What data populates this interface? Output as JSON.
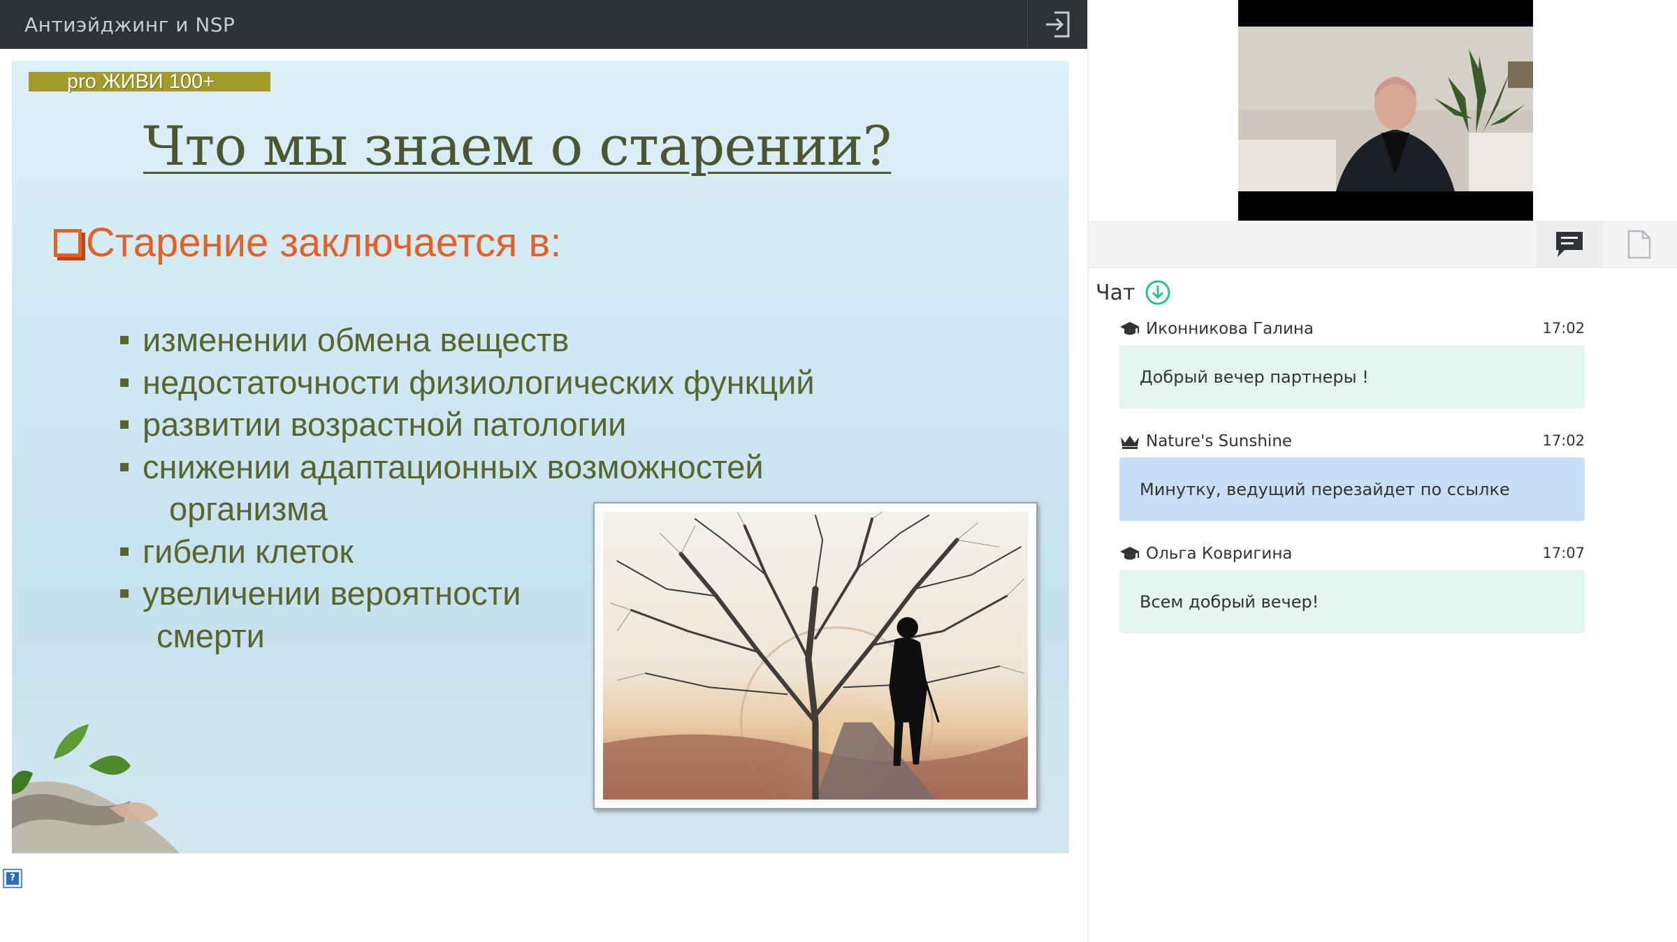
{
  "window": {
    "title": "Антиэйджинг и NSP",
    "exit_icon": "exit-icon"
  },
  "slide": {
    "badge": "pro ЖИВИ  100+",
    "heading": "Что мы знаем о старении?",
    "subheading": "Старение заключается в:",
    "bullets": [
      "изменении обмена веществ",
      "недостаточности физиологических функций",
      "развитии возрастной патологии",
      " снижении адаптационных возможностей",
      "гибели клеток",
      "увеличении вероятности"
    ],
    "continuations": [
      "организма",
      "смерти"
    ],
    "colors": {
      "heading": "#4c5633",
      "subheading": "#e0612a",
      "bullets": "#58652f"
    }
  },
  "help": {
    "label": "?"
  },
  "panel": {
    "toolbar": {
      "chat_icon": "chat-bubble-icon",
      "files_icon": "document-icon"
    },
    "chat": {
      "title": "Чат",
      "download_icon": "download-circle-icon",
      "messages": [
        {
          "author": "Иконникова Галина",
          "role_icon": "graduation-cap-icon",
          "time": "17:02",
          "text": "Добрый вечер партнеры !",
          "color": "#e3f6ee"
        },
        {
          "author": "Nature's Sunshine",
          "role_icon": "crown-icon",
          "time": "17:02",
          "text": "Минутку, ведущий перезайдет по ссылке",
          "color": "#c8dff5"
        },
        {
          "author": "Ольга Ковригина",
          "role_icon": "graduation-cap-icon",
          "time": "17:07",
          "text": "Всем добрый вечер!",
          "color": "#e3f6ee"
        }
      ]
    }
  }
}
